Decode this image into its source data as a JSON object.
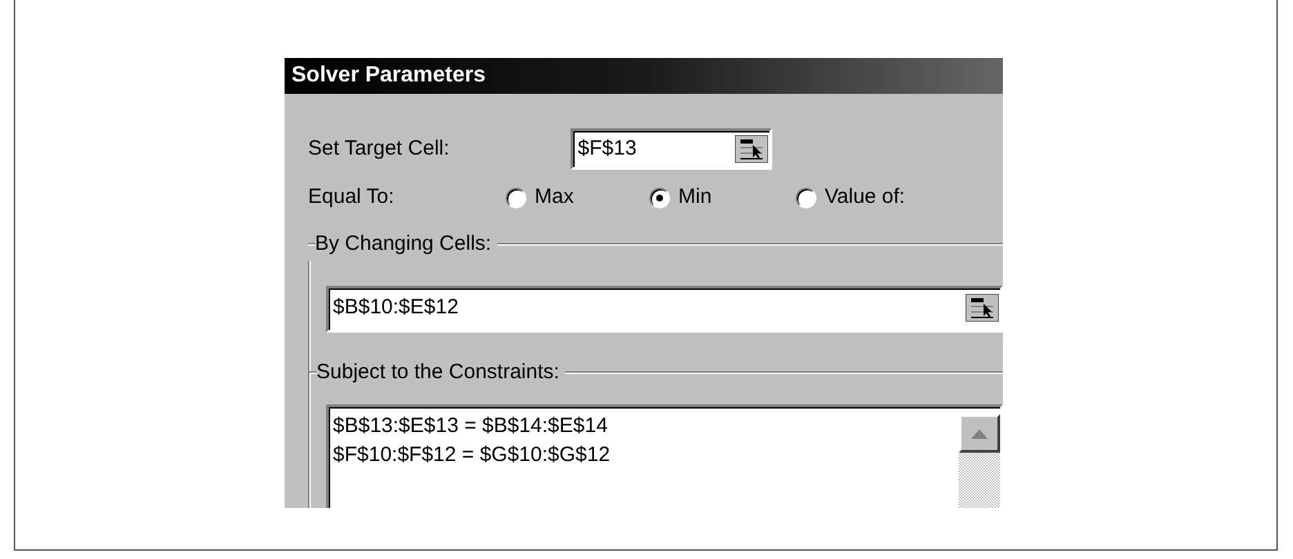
{
  "window": {
    "title": "Solver Parameters"
  },
  "target_cell": {
    "label": "Set Target Cell:",
    "value": "$F$13"
  },
  "equal_to": {
    "label": "Equal To:",
    "options": [
      {
        "label": "Max",
        "selected": false
      },
      {
        "label": "Min",
        "selected": true
      },
      {
        "label": "Value of:",
        "selected": false
      }
    ]
  },
  "changing_cells": {
    "label": "By Changing Cells:",
    "value": "$B$10:$E$12"
  },
  "constraints": {
    "label": "Subject to the Constraints:",
    "items": [
      "$B$13:$E$13 = $B$14:$E$14",
      "$F$10:$F$12 = $G$10:$G$12"
    ]
  }
}
